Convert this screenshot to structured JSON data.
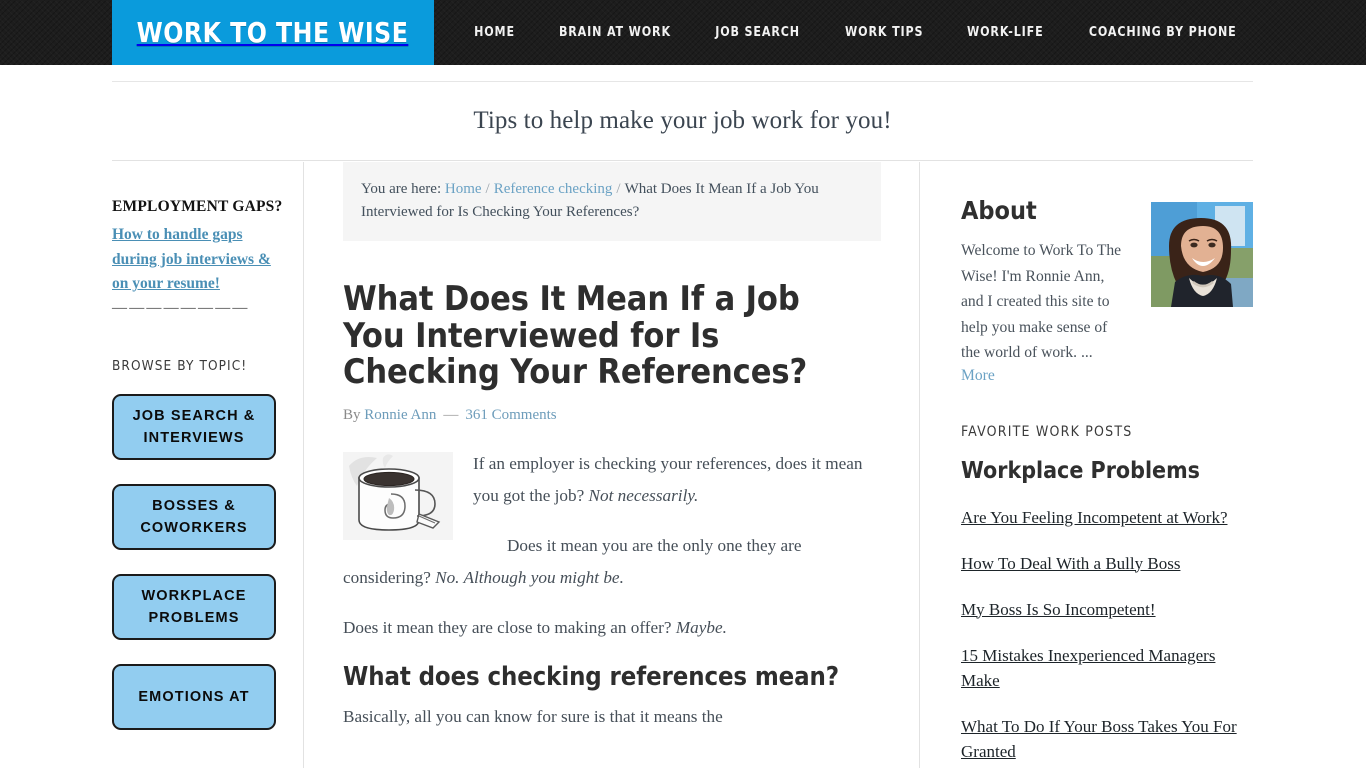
{
  "header": {
    "logo_text": "WORK TO THE WISE",
    "logo_bg": "#0a9bdc",
    "bar_bg": "#1d1d1d",
    "nav": [
      {
        "label": "HOME"
      },
      {
        "label": "BRAIN AT WORK"
      },
      {
        "label": "JOB SEARCH"
      },
      {
        "label": "WORK TIPS"
      },
      {
        "label": "WORK-LIFE"
      },
      {
        "label": "COACHING BY PHONE"
      }
    ]
  },
  "tagline": "Tips to help make your job work for you!",
  "sidebar_left": {
    "promo_title": "EMPLOYMENT GAPS?",
    "promo_link": "How to handle gaps during job interviews & on your resume!",
    "divider_dashes": "————————",
    "browse_heading": "BROWSE BY TOPIC!",
    "topic_buttons": [
      {
        "label": "JOB SEARCH & INTERVIEWS"
      },
      {
        "label": "BOSSES & COWORKERS"
      },
      {
        "label": "WORKPLACE PROBLEMS"
      },
      {
        "label": "EMOTIONS AT"
      }
    ],
    "button_color": "#92cdf0"
  },
  "breadcrumb": {
    "prefix": "You are here:",
    "home": "Home",
    "category": "Reference checking",
    "current": "What Does It Mean If a Job You Interviewed for Is Checking Your References?",
    "separator": "/"
  },
  "article": {
    "title": "What Does It Mean If a Job You Interviewed for Is Checking Your References?",
    "by_label": "By",
    "author": "Ronnie Ann",
    "dash": "—",
    "comments": "361 Comments",
    "image_alt": "coffee-mug-sketch",
    "para1_a": "If an employer is checking your references, does it mean you got the job? ",
    "para1_em": "Not necessarily.",
    "para2_a": "Does it mean you are the only one they are considering? ",
    "para2_em": "No. Although you might be.",
    "para3_a": "Does it mean they are close to making an offer? ",
    "para3_em": "Maybe.",
    "subheading": "What does checking references mean?",
    "para4": "Basically, all you can know for sure is that it means the"
  },
  "sidebar_right": {
    "about_heading": "About",
    "about_text": "Welcome to Work To The Wise! I'm Ronnie Ann, and I created this site to help you make sense of the world of work. ...",
    "about_more": "More",
    "favorite_heading": "FAVORITE WORK POSTS",
    "favorite_subheading": "Workplace Problems",
    "favorite_links": [
      {
        "label": "Are You Feeling Incompetent at Work?"
      },
      {
        "label": "How To Deal With a Bully Boss"
      },
      {
        "label": "My Boss Is So Incompetent!"
      },
      {
        "label": "15 Mistakes Inexperienced Managers Make"
      },
      {
        "label": "What To Do If Your Boss Takes You For Granted"
      }
    ]
  }
}
